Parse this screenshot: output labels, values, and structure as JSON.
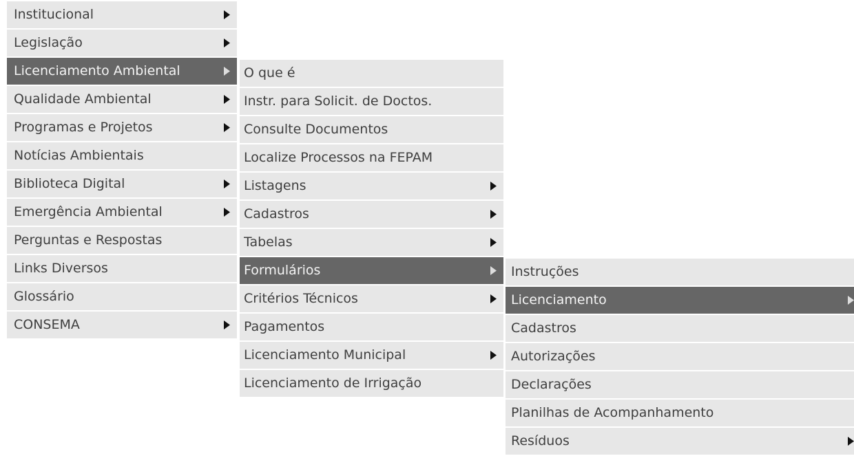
{
  "menus": [
    {
      "items": [
        {
          "label": "Institucional",
          "has_submenu": true,
          "active": false
        },
        {
          "label": "Legislação",
          "has_submenu": true,
          "active": false
        },
        {
          "label": "Licenciamento Ambiental",
          "has_submenu": true,
          "active": true
        },
        {
          "label": "Qualidade Ambiental",
          "has_submenu": true,
          "active": false
        },
        {
          "label": "Programas e Projetos",
          "has_submenu": true,
          "active": false
        },
        {
          "label": "Notícias Ambientais",
          "has_submenu": false,
          "active": false
        },
        {
          "label": "Biblioteca Digital",
          "has_submenu": true,
          "active": false
        },
        {
          "label": "Emergência Ambiental",
          "has_submenu": true,
          "active": false
        },
        {
          "label": "Perguntas e Respostas",
          "has_submenu": false,
          "active": false
        },
        {
          "label": "Links Diversos",
          "has_submenu": false,
          "active": false
        },
        {
          "label": "Glossário",
          "has_submenu": false,
          "active": false
        },
        {
          "label": "CONSEMA",
          "has_submenu": true,
          "active": false
        }
      ]
    },
    {
      "items": [
        {
          "label": "O que é",
          "has_submenu": false,
          "active": false
        },
        {
          "label": "Instr. para Solicit. de Doctos.",
          "has_submenu": false,
          "active": false
        },
        {
          "label": "Consulte Documentos",
          "has_submenu": false,
          "active": false
        },
        {
          "label": "Localize Processos na FEPAM",
          "has_submenu": false,
          "active": false
        },
        {
          "label": "Listagens",
          "has_submenu": true,
          "active": false
        },
        {
          "label": "Cadastros",
          "has_submenu": true,
          "active": false
        },
        {
          "label": "Tabelas",
          "has_submenu": true,
          "active": false
        },
        {
          "label": "Formulários",
          "has_submenu": true,
          "active": true
        },
        {
          "label": "Critérios Técnicos",
          "has_submenu": true,
          "active": false
        },
        {
          "label": "Pagamentos",
          "has_submenu": false,
          "active": false
        },
        {
          "label": "Licenciamento Municipal",
          "has_submenu": true,
          "active": false
        },
        {
          "label": "Licenciamento de Irrigação",
          "has_submenu": false,
          "active": false
        }
      ]
    },
    {
      "items": [
        {
          "label": "Instruções",
          "has_submenu": false,
          "active": false
        },
        {
          "label": "Licenciamento",
          "has_submenu": true,
          "active": true
        },
        {
          "label": "Cadastros",
          "has_submenu": false,
          "active": false
        },
        {
          "label": "Autorizações",
          "has_submenu": false,
          "active": false
        },
        {
          "label": "Declarações",
          "has_submenu": false,
          "active": false
        },
        {
          "label": "Planilhas de Acompanhamento",
          "has_submenu": false,
          "active": false
        },
        {
          "label": "Resíduos",
          "has_submenu": true,
          "active": false
        }
      ]
    }
  ],
  "colors": {
    "item_background": "#e7e7e7",
    "active_background": "#666666",
    "item_text": "#3f3f3f",
    "active_text": "#f4f4f4",
    "arrow": "#111111"
  },
  "icons": {
    "submenu_arrow": "caret-right-icon"
  }
}
